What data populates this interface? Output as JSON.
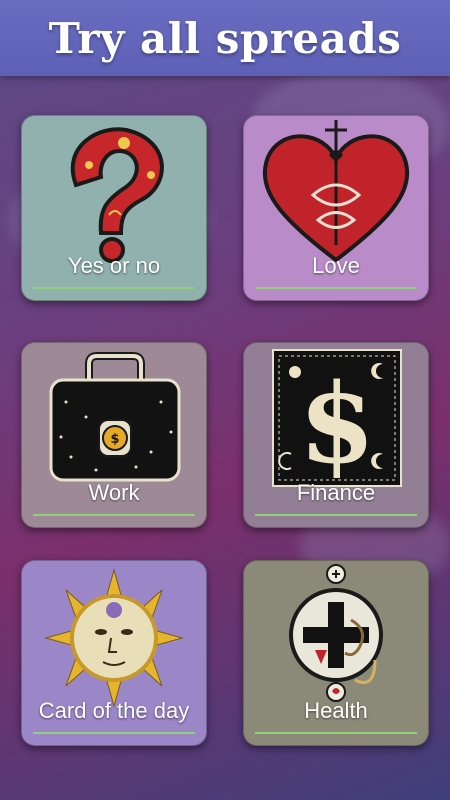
{
  "header": {
    "title": "Try all spreads"
  },
  "spreads": [
    {
      "label": "Yes or no",
      "icon": "question-mark-icon"
    },
    {
      "label": "Love",
      "icon": "heart-icon"
    },
    {
      "label": "Work",
      "icon": "briefcase-icon"
    },
    {
      "label": "Finance",
      "icon": "dollar-icon"
    },
    {
      "label": "Card of the day",
      "icon": "sun-icon"
    },
    {
      "label": "Health",
      "icon": "medical-cross-icon"
    }
  ],
  "colors": {
    "header_bg": "#5d60b6",
    "underline": "#8fd17a"
  }
}
